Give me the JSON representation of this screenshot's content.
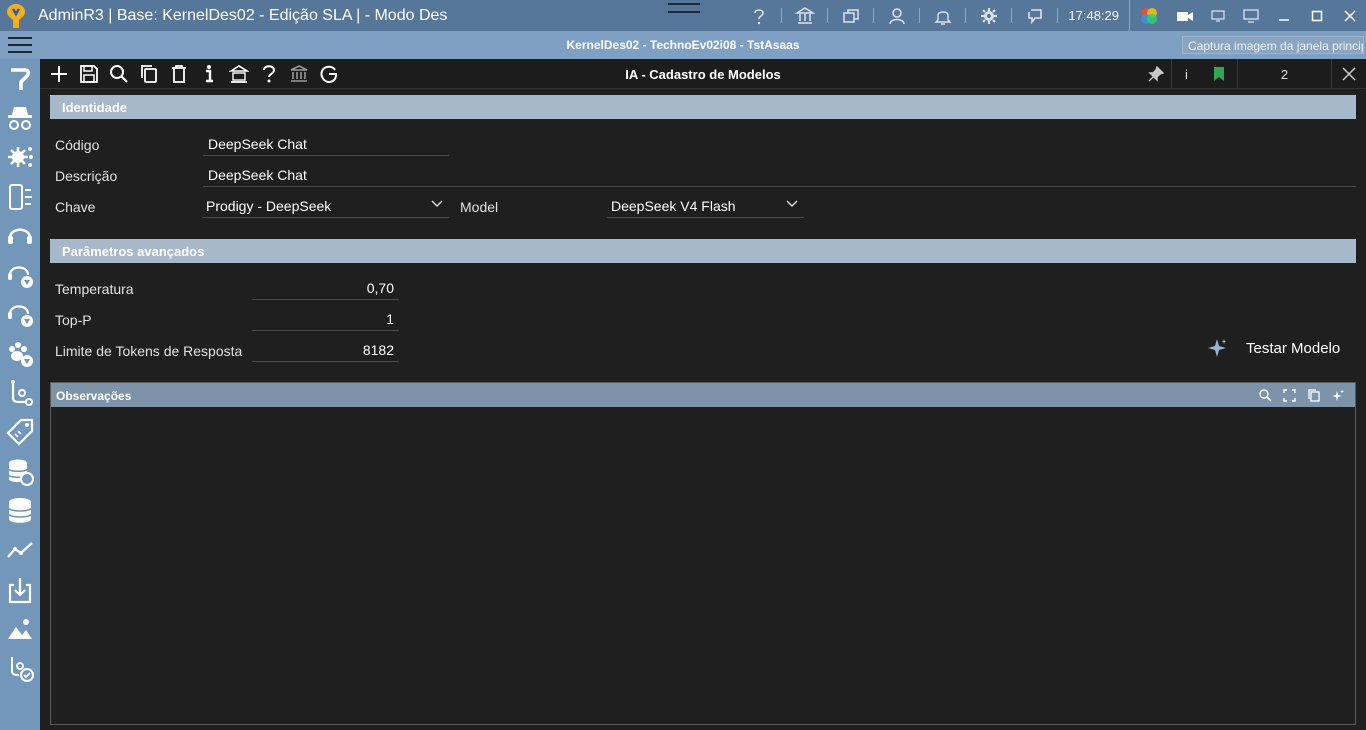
{
  "window": {
    "title": "AdminR3 | Base: KernelDes02 - Edição SLA | - Modo Des",
    "clock": "17:48:29",
    "icons": [
      "help-icon",
      "bank-icon",
      "windows-icon",
      "user-icon",
      "bell-icon",
      "gear-icon",
      "chat-icon",
      "apps-icon",
      "video-icon",
      "monitor-small-icon",
      "monitor-icon"
    ],
    "accent": "#56779a"
  },
  "subbar": {
    "title": "KernelDes02 - TechnoEv02i08 - TstAsaas",
    "tooltip": "Captura imagem da janela principal"
  },
  "toolbar": {
    "form_title": "IA - Cadastro de Modelos",
    "info_label": "i",
    "count": "2"
  },
  "sections": {
    "identity": "Identidade",
    "advanced": "Parâmetros avançados"
  },
  "fields": {
    "codigo": {
      "label": "Código",
      "value": "DeepSeek Chat"
    },
    "descricao": {
      "label": "Descrição",
      "value": "DeepSeek Chat"
    },
    "chave": {
      "label": "Chave",
      "value": "Prodigy - DeepSeek"
    },
    "model": {
      "label": "Model",
      "value": "DeepSeek V4 Flash"
    },
    "temperatura": {
      "label": "Temperatura",
      "value": "0,70"
    },
    "top_p": {
      "label": "Top-P",
      "value": "1"
    },
    "limite": {
      "label": "Limite de Tokens de Resposta",
      "value": "8182"
    }
  },
  "test_button": "Testar Modelo",
  "observacoes": {
    "title": "Observações",
    "value": ""
  }
}
